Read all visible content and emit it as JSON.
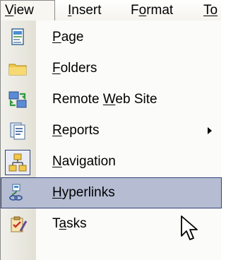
{
  "menubar": {
    "tabs": [
      {
        "pre": "",
        "mn": "V",
        "post": "iew"
      },
      {
        "pre": "",
        "mn": "I",
        "post": "nsert"
      },
      {
        "pre": "F",
        "mn": "o",
        "post": "rmat"
      },
      {
        "pre": "",
        "mn": "To",
        "post": ""
      }
    ]
  },
  "view_menu": {
    "items": [
      {
        "pre": "",
        "mn": "P",
        "post": "age",
        "icon": "page-icon"
      },
      {
        "pre": "",
        "mn": "F",
        "post": "olders",
        "icon": "folder-icon"
      },
      {
        "pre": "Remote ",
        "mn": "W",
        "post": "eb Site",
        "icon": "remote-web-site-icon"
      },
      {
        "pre": "",
        "mn": "R",
        "post": "eports",
        "icon": "reports-icon",
        "has_submenu": true
      },
      {
        "pre": "",
        "mn": "N",
        "post": "avigation",
        "icon": "navigation-icon",
        "checked": true
      },
      {
        "pre": "",
        "mn": "H",
        "post": "yperlinks",
        "icon": "hyperlinks-icon",
        "highlighted": true
      },
      {
        "pre": "T",
        "mn": "a",
        "post": "sks",
        "icon": "tasks-icon"
      }
    ]
  },
  "colors": {
    "highlight_bg": "#b6bdd2",
    "highlight_border": "#30427a",
    "icon_strip": "#e3e1d6"
  }
}
